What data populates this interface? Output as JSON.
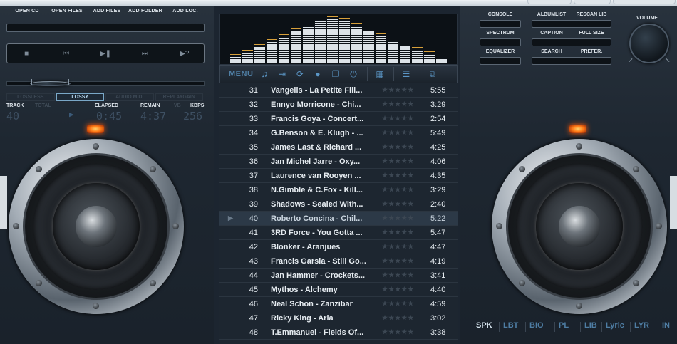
{
  "top_buttons": [
    "OPEN CD",
    "OPEN FILES",
    "ADD FILES",
    "ADD FOLDER",
    "ADD LOC."
  ],
  "transport": [
    {
      "name": "stop-button",
      "icon": "stop-icon",
      "glyph": "■"
    },
    {
      "name": "previous-button",
      "icon": "previous-icon",
      "glyph": "⏮"
    },
    {
      "name": "play-pause-button",
      "icon": "play-pause-icon",
      "glyph": "▶❚"
    },
    {
      "name": "next-button",
      "icon": "next-icon",
      "glyph": "⏭"
    },
    {
      "name": "random-button",
      "icon": "random-icon",
      "glyph": "▶?"
    }
  ],
  "formats": [
    {
      "label": "LOSSLESS",
      "active": false
    },
    {
      "label": "LOSSY",
      "active": true
    },
    {
      "label": "AUDIO MIDI",
      "active": false
    },
    {
      "label": "REPLAYGAIN",
      "active": false
    }
  ],
  "info": {
    "track_label": "TRACK",
    "total_label": "TOTAL",
    "elapsed_label": "ELAPSED",
    "remain_label": "REMAIN",
    "vb_label": "VB",
    "kbps_label": "KBPS",
    "track": "40",
    "elapsed": "0:45",
    "remain": "4:37",
    "kbps": "256"
  },
  "menu_label": "MENU",
  "right_buttons": {
    "console": "CONSOLE",
    "spectrum": "SPECTRUM",
    "equalizer": "EQUALIZER",
    "albumlist": "ALBUMLIST",
    "rescan": "RESCAN LIB",
    "caption": "CAPTION",
    "fullsize": "FULL SIZE",
    "search": "SEARCH",
    "prefer": "PREFER.",
    "volume": "VOLUME"
  },
  "spectrum_levels": [
    0.12,
    0.22,
    0.34,
    0.46,
    0.56,
    0.68,
    0.8,
    0.9,
    0.96,
    0.92,
    0.82,
    0.7,
    0.58,
    0.48,
    0.38,
    0.28,
    0.18,
    0.1
  ],
  "playlist": [
    {
      "num": "31",
      "title": "Vangelis - La Petite Fill...",
      "dur": "5:55"
    },
    {
      "num": "32",
      "title": "Ennyo Morricone - Chi...",
      "dur": "3:29"
    },
    {
      "num": "33",
      "title": "Francis Goya - Concert...",
      "dur": "2:54"
    },
    {
      "num": "34",
      "title": "G.Benson & E. Klugh - ...",
      "dur": "5:49"
    },
    {
      "num": "35",
      "title": "James Last & Richard ...",
      "dur": "4:25"
    },
    {
      "num": "36",
      "title": "Jan Michel Jarre - Oxy...",
      "dur": "4:06"
    },
    {
      "num": "37",
      "title": "Laurence van Rooyen ...",
      "dur": "4:35"
    },
    {
      "num": "38",
      "title": "N.Gimble & C.Fox - Kill...",
      "dur": "3:29"
    },
    {
      "num": "39",
      "title": "Shadows - Sealed With...",
      "dur": "2:40"
    },
    {
      "num": "40",
      "title": "Roberto Concina - Chil...",
      "dur": "5:22",
      "current": true
    },
    {
      "num": "41",
      "title": "3RD Force - You Gotta ...",
      "dur": "5:47"
    },
    {
      "num": "42",
      "title": "Blonker - Aranjues",
      "dur": "4:47"
    },
    {
      "num": "43",
      "title": "Francis Garsia - Still Go...",
      "dur": "4:19"
    },
    {
      "num": "44",
      "title": "Jan Hammer - Crockets...",
      "dur": "3:41"
    },
    {
      "num": "45",
      "title": "Mythos - Alchemy",
      "dur": "4:40"
    },
    {
      "num": "46",
      "title": "Neal Schon - Zanzibar",
      "dur": "4:59"
    },
    {
      "num": "47",
      "title": "Ricky King - Aria",
      "dur": "3:02"
    },
    {
      "num": "48",
      "title": "T.Emmanuel - Fields Of...",
      "dur": "3:38"
    }
  ],
  "bottom_tabs": [
    {
      "label": "SPK",
      "active": true
    },
    {
      "label": "LBT",
      "active": false
    },
    {
      "label": "BIO",
      "active": false
    },
    {
      "label": "PL",
      "active": false
    },
    {
      "label": "LIB",
      "active": false
    },
    {
      "label": "Lyric",
      "active": false
    },
    {
      "label": "LYR",
      "active": false
    },
    {
      "label": "IN",
      "active": false
    }
  ]
}
